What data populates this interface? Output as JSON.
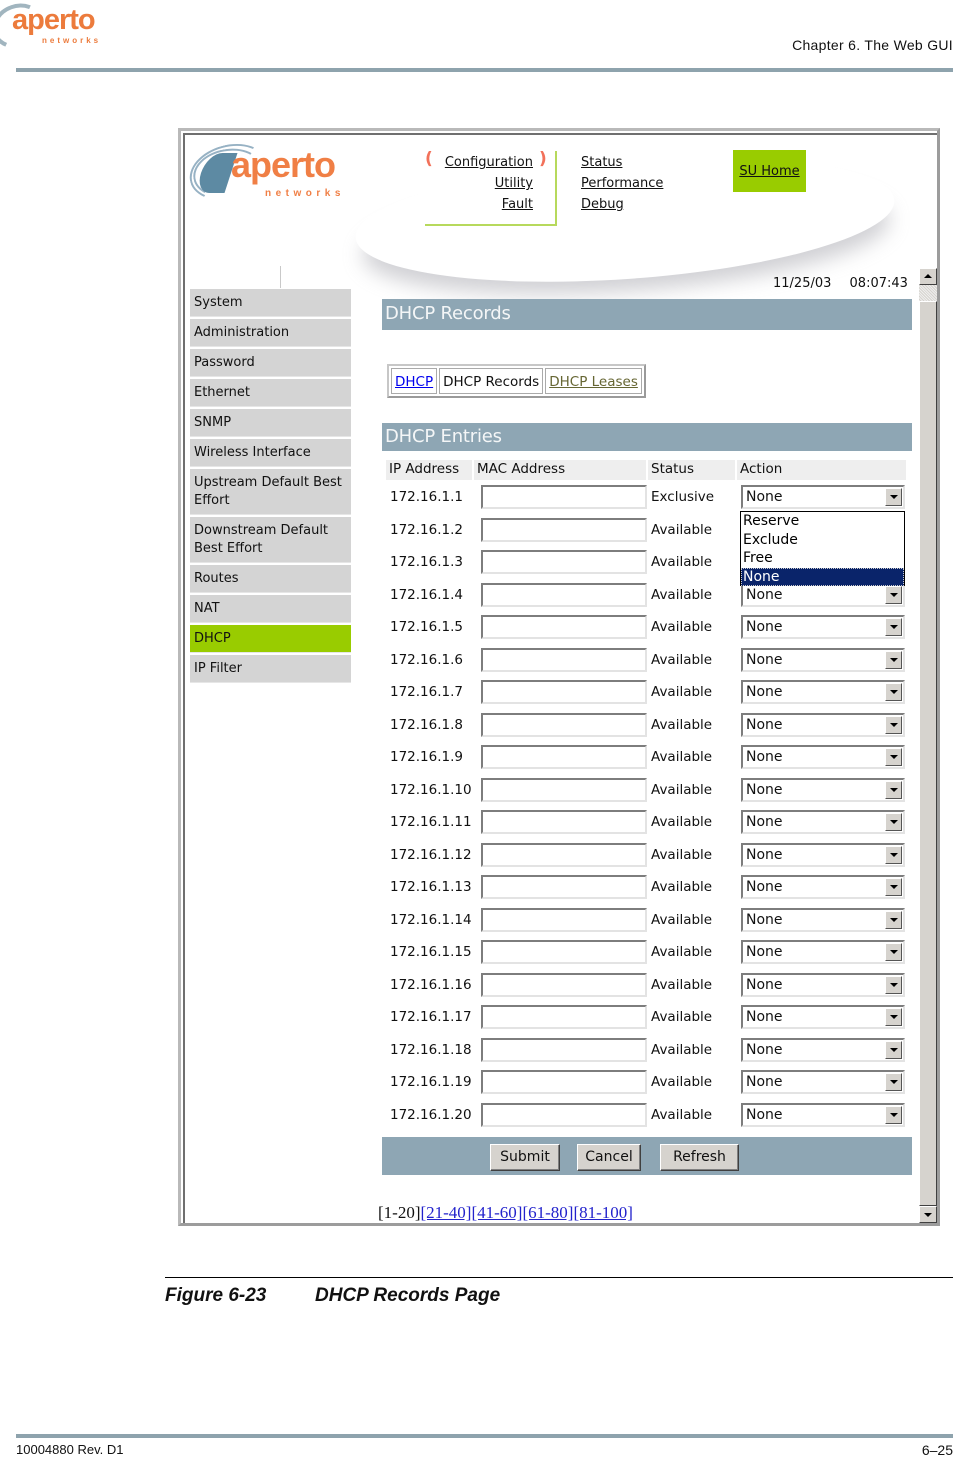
{
  "document": {
    "brand": "aperto",
    "brand_sub": "networks",
    "chapter": "Chapter 6.  The Web GUI",
    "figure_label": "Figure 6-23",
    "figure_title": "DHCP Records Page",
    "doc_number": "10004880 Rev. D1",
    "page_number": "6–25"
  },
  "gui": {
    "brand": "aperto",
    "brand_sub": "networks",
    "menu_left": [
      "Configuration",
      "Utility",
      "Fault"
    ],
    "menu_right": [
      "Status",
      "Performance",
      "Debug"
    ],
    "su_home": "SU Home",
    "date": "11/25/03",
    "time": "08:07:43",
    "accent_color": "#99cc00",
    "bar_color": "#8ea6b4",
    "sidebar": [
      {
        "label": "System"
      },
      {
        "label": "Administration"
      },
      {
        "label": "Password"
      },
      {
        "label": "Ethernet"
      },
      {
        "label": "SNMP"
      },
      {
        "label": "Wireless Interface"
      },
      {
        "label": "Upstream Default Best Effort"
      },
      {
        "label": "Downstream Default Best Effort"
      },
      {
        "label": "Routes"
      },
      {
        "label": "NAT"
      },
      {
        "label": "DHCP",
        "active": true
      },
      {
        "label": "IP Filter"
      }
    ],
    "page_title": "DHCP Records",
    "tabs": [
      "DHCP",
      "DHCP Records",
      "DHCP Leases"
    ],
    "section_title": "DHCP Entries",
    "columns": [
      "IP Address",
      "MAC Address",
      "Status",
      "Action"
    ],
    "rows": [
      {
        "ip": "172.16.1.1",
        "mac": "",
        "status": "Exclusive",
        "action": "None"
      },
      {
        "ip": "172.16.1.2",
        "mac": "",
        "status": "Available",
        "action": "None"
      },
      {
        "ip": "172.16.1.3",
        "mac": "",
        "status": "Available",
        "action": "None"
      },
      {
        "ip": "172.16.1.4",
        "mac": "",
        "status": "Available",
        "action": "None"
      },
      {
        "ip": "172.16.1.5",
        "mac": "",
        "status": "Available",
        "action": "None"
      },
      {
        "ip": "172.16.1.6",
        "mac": "",
        "status": "Available",
        "action": "None"
      },
      {
        "ip": "172.16.1.7",
        "mac": "",
        "status": "Available",
        "action": "None"
      },
      {
        "ip": "172.16.1.8",
        "mac": "",
        "status": "Available",
        "action": "None"
      },
      {
        "ip": "172.16.1.9",
        "mac": "",
        "status": "Available",
        "action": "None"
      },
      {
        "ip": "172.16.1.10",
        "mac": "",
        "status": "Available",
        "action": "None"
      },
      {
        "ip": "172.16.1.11",
        "mac": "",
        "status": "Available",
        "action": "None"
      },
      {
        "ip": "172.16.1.12",
        "mac": "",
        "status": "Available",
        "action": "None"
      },
      {
        "ip": "172.16.1.13",
        "mac": "",
        "status": "Available",
        "action": "None"
      },
      {
        "ip": "172.16.1.14",
        "mac": "",
        "status": "Available",
        "action": "None"
      },
      {
        "ip": "172.16.1.15",
        "mac": "",
        "status": "Available",
        "action": "None"
      },
      {
        "ip": "172.16.1.16",
        "mac": "",
        "status": "Available",
        "action": "None"
      },
      {
        "ip": "172.16.1.17",
        "mac": "",
        "status": "Available",
        "action": "None"
      },
      {
        "ip": "172.16.1.18",
        "mac": "",
        "status": "Available",
        "action": "None"
      },
      {
        "ip": "172.16.1.19",
        "mac": "",
        "status": "Available",
        "action": "None"
      },
      {
        "ip": "172.16.1.20",
        "mac": "",
        "status": "Available",
        "action": "None"
      }
    ],
    "dropdown_open": {
      "options": [
        "Reserve",
        "Exclude",
        "Free",
        "None"
      ],
      "highlighted": "None"
    },
    "buttons": {
      "submit": "Submit",
      "cancel": "Cancel",
      "refresh": "Refresh"
    },
    "pager": {
      "current": "[1-20]",
      "links": [
        "[21-40]",
        "[41-60]",
        "[61-80]",
        "[81-100]"
      ]
    }
  }
}
